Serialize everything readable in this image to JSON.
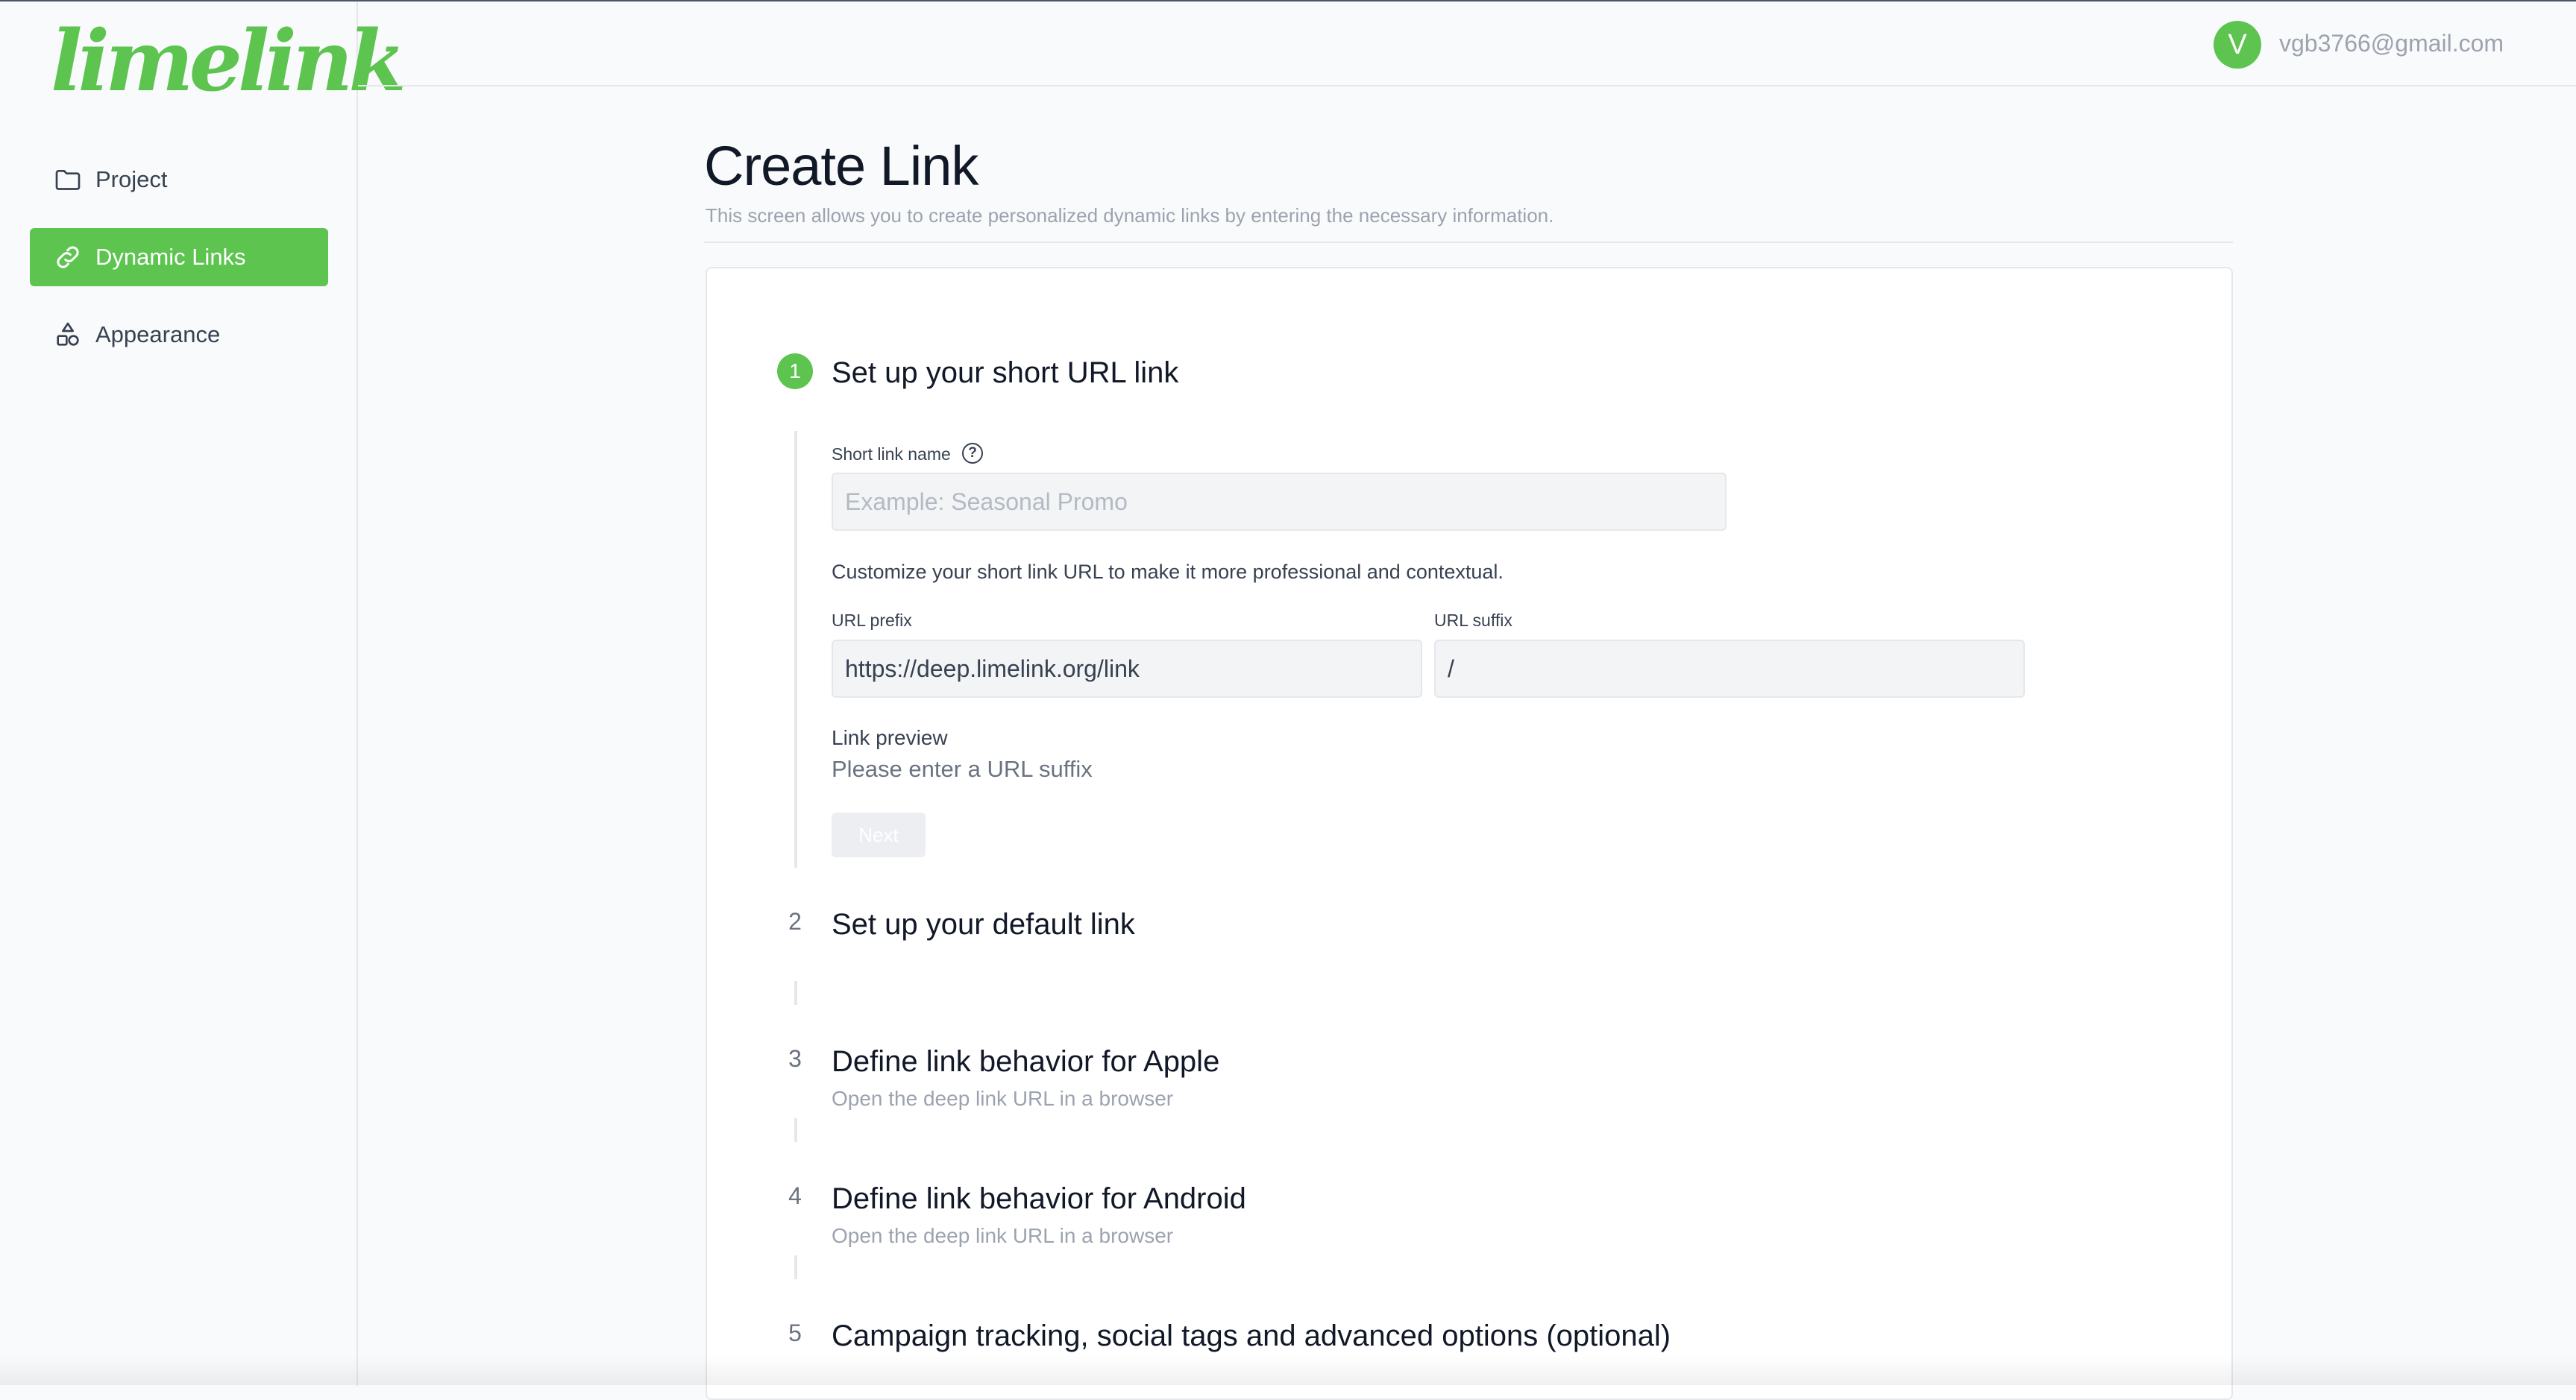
{
  "brand": {
    "logo_text": "limelink",
    "accent_color": "#5cc44f"
  },
  "sidebar": {
    "items": [
      {
        "label": "Project",
        "icon": "folder-icon",
        "active": false
      },
      {
        "label": "Dynamic Links",
        "icon": "link-icon",
        "active": true
      },
      {
        "label": "Appearance",
        "icon": "shapes-icon",
        "active": false
      }
    ]
  },
  "header": {
    "avatar_initial": "V",
    "user_email": "vgb3766@gmail.com"
  },
  "page": {
    "title": "Create Link",
    "subtitle": "This screen allows you to create personalized dynamic links by entering the necessary information."
  },
  "steps": [
    {
      "number": "1",
      "title": "Set up your short URL link",
      "short_link_name_label": "Short link name",
      "help_icon_glyph": "?",
      "short_link_name_placeholder": "Example: Seasonal Promo",
      "short_link_name_value": "",
      "customize_text": "Customize your short link URL to make it more professional and contextual.",
      "url_prefix_label": "URL prefix",
      "url_prefix_value": "https://deep.limelink.org/link",
      "url_suffix_label": "URL suffix",
      "url_suffix_value": "/",
      "link_preview_label": "Link preview",
      "link_preview_value": "Please enter a URL suffix",
      "next_label": "Next"
    },
    {
      "number": "2",
      "title": "Set up your default link",
      "description": ""
    },
    {
      "number": "3",
      "title": "Define link behavior for Apple",
      "description": "Open the deep link URL in a browser"
    },
    {
      "number": "4",
      "title": "Define link behavior for Android",
      "description": "Open the deep link URL in a browser"
    },
    {
      "number": "5",
      "title": "Campaign tracking, social tags and advanced options (optional)",
      "description": ""
    }
  ]
}
